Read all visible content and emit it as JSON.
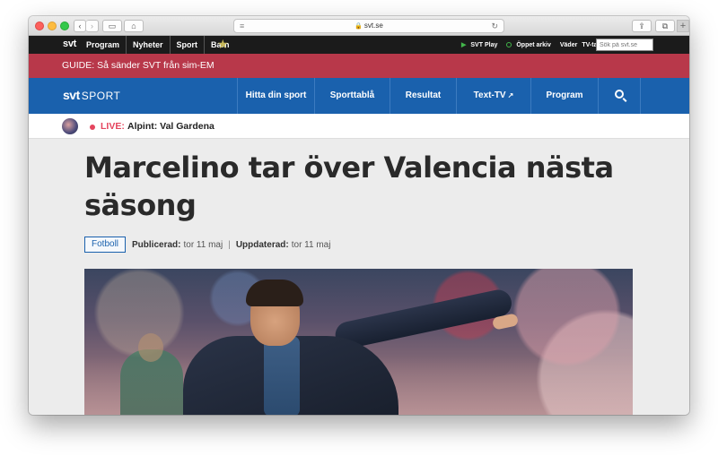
{
  "browser": {
    "url": "svt.se"
  },
  "topbar": {
    "logo": "svt",
    "nav": [
      "Program",
      "Nyheter",
      "Sport",
      "Barn"
    ],
    "right_links": {
      "svt_play": "SVT Play",
      "oppet_arkiv": "Öppet arkiv",
      "vader": "Väder",
      "tv_tabla": "TV-tablå"
    },
    "search_placeholder": "Sök på svt.se"
  },
  "guide": {
    "text": "GUIDE: Så sänder SVT från sim-EM"
  },
  "sport_header": {
    "logo_svt": "svt",
    "logo_sport": "SPORT",
    "nav": {
      "hitta": "Hitta din sport",
      "sporttabla": "Sporttablå",
      "resultat": "Resultat",
      "texttv": "Text-TV",
      "program": "Program"
    }
  },
  "live": {
    "label": "LIVE:",
    "title": "Alpint: Val Gardena"
  },
  "article": {
    "headline": "Marcelino tar över Valencia nästa säsong",
    "tag": "Fotboll",
    "published_label": "Publicerad:",
    "published_value": "tor 11 maj",
    "updated_label": "Uppdaterad:",
    "updated_value": "tor 11 maj"
  },
  "colors": {
    "guide_bar": "#b8384a",
    "sport_bar": "#1a61ad",
    "live_red": "#e5455e"
  }
}
